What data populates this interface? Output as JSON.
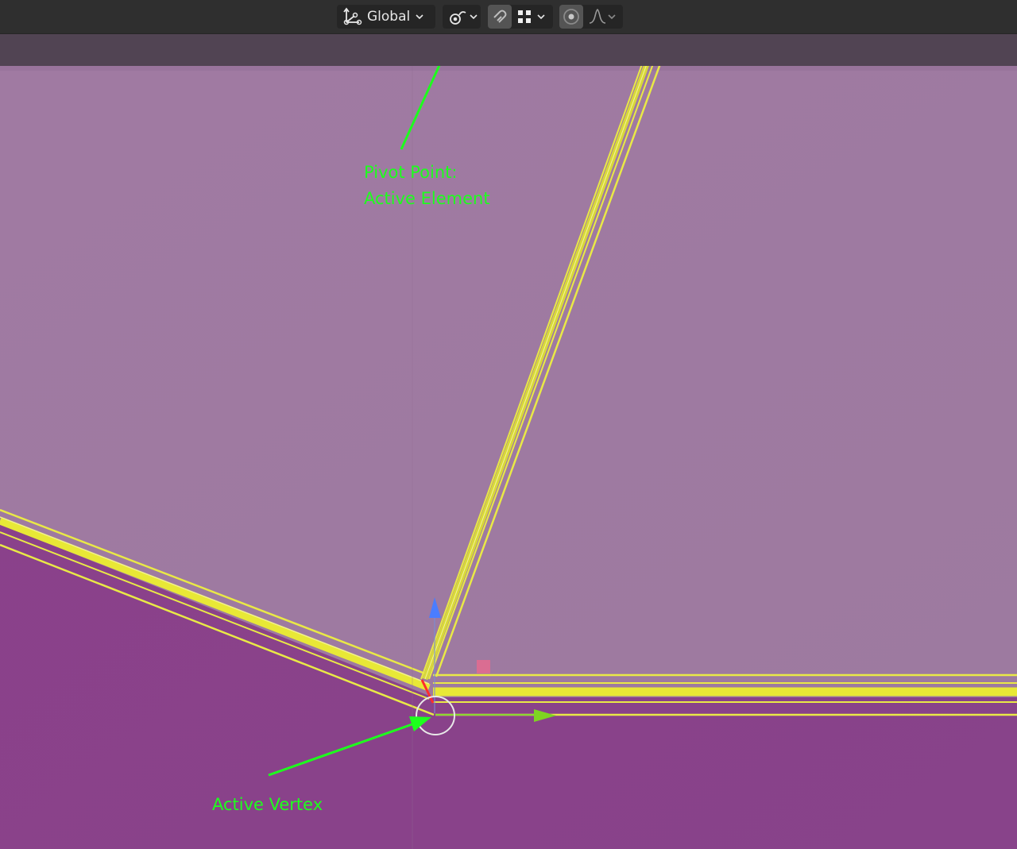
{
  "toolbar": {
    "transform_orientation": {
      "label": "Global",
      "icon": "transform-orientation-icon",
      "dropdown_icon": "chevron-down-icon"
    },
    "pivot_point": {
      "icon": "pivot-active-element-icon",
      "dropdown_icon": "chevron-down-icon"
    },
    "snapping": {
      "toggle_icon": "magnet-icon",
      "element_icon": "snap-vertex-grid-icon",
      "dropdown_icon": "chevron-down-icon"
    },
    "proportional_editing": {
      "toggle_icon": "proportional-editing-icon",
      "falloff_icon": "falloff-curve-icon",
      "dropdown_icon": "chevron-down-icon"
    }
  },
  "annotations": {
    "pivot_point": {
      "line1": "Pivot Point:",
      "line2": "Active Element"
    },
    "active_vertex": {
      "label": "Active Vertex"
    }
  },
  "colors": {
    "toolbar_bg": "#2f2f2f",
    "header_strip": "#514453",
    "upper_face": "#9e7aa1",
    "lower_face": "#8a428a",
    "selected_edge": "#e8e836",
    "annotation": "#1dff1d",
    "gizmo_y_axis": "#7ed321",
    "gizmo_z_axis": "#4a7dff",
    "gizmo_x_axis": "#ff3b3b"
  }
}
